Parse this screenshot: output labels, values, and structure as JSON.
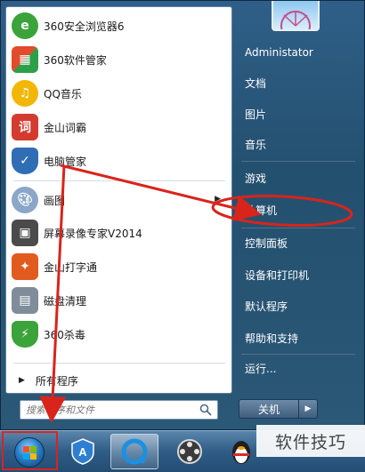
{
  "pinned_programs": [
    {
      "label": "360安全浏览器6",
      "icon": "browser-360-icon",
      "color": "#3aa33a"
    },
    {
      "label": "360软件管家",
      "icon": "software-manager-icon",
      "color": "#e24b2b"
    },
    {
      "label": "QQ音乐",
      "icon": "qq-music-icon",
      "color": "#f2b705"
    },
    {
      "label": "金山词霸",
      "icon": "dictionary-icon",
      "color": "#d43b2f"
    },
    {
      "label": "电脑管家",
      "icon": "pc-manager-shield-icon",
      "color": "#2f6db4"
    }
  ],
  "recent_programs": [
    {
      "label": "画图",
      "icon": "paint-icon",
      "color": "#8aa7c8",
      "has_submenu": true
    },
    {
      "label": "屏幕录像专家V2014",
      "icon": "screen-recorder-icon",
      "color": "#4b4b4b"
    },
    {
      "label": "金山打字通",
      "icon": "typing-icon",
      "color": "#e25b1e"
    },
    {
      "label": "磁盘清理",
      "icon": "disk-cleanup-icon",
      "color": "#7f8c99"
    },
    {
      "label": "360杀毒",
      "icon": "antivirus-360-icon",
      "color": "#3aa33a"
    }
  ],
  "all_programs_label": "所有程序",
  "search": {
    "placeholder": "搜索程序和文件"
  },
  "right_links": [
    {
      "label": "Administator",
      "name": "user-name"
    },
    {
      "label": "文档",
      "name": "link-documents"
    },
    {
      "label": "图片",
      "name": "link-pictures"
    },
    {
      "label": "音乐",
      "name": "link-music"
    },
    {
      "label": "游戏",
      "name": "link-games"
    },
    {
      "label": "计算机",
      "name": "link-computer"
    },
    {
      "label": "控制面板",
      "name": "link-control-panel"
    },
    {
      "label": "设备和打印机",
      "name": "link-devices-printers"
    },
    {
      "label": "默认程序",
      "name": "link-default-programs"
    },
    {
      "label": "帮助和支持",
      "name": "link-help-support"
    },
    {
      "label": "运行...",
      "name": "link-run"
    }
  ],
  "shutdown_label": "关机",
  "taskbar": {
    "apps": [
      "start-orb-icon",
      "app-store-icon",
      "browser-icon",
      "media-player-icon",
      "qq-penguin-icon"
    ]
  },
  "watermark": "软件技巧",
  "colors": {
    "annotation": "#d9241b",
    "accent": "#2f5f88"
  }
}
